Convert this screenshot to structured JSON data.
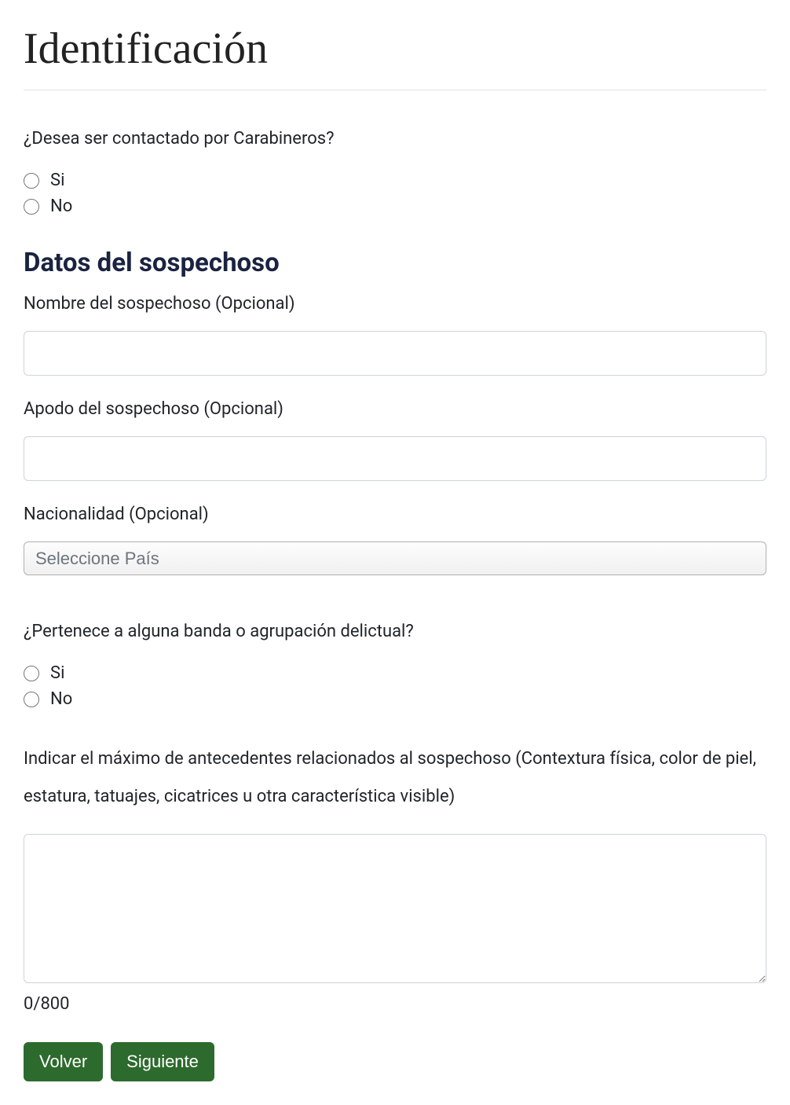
{
  "page": {
    "title": "Identificación"
  },
  "contact_question": {
    "label": "¿Desea ser contactado por Carabineros?",
    "options": {
      "yes": "Si",
      "no": "No"
    }
  },
  "suspect_section": {
    "heading": "Datos del sospechoso",
    "name": {
      "label": "Nombre del sospechoso (Opcional)",
      "value": ""
    },
    "nickname": {
      "label": "Apodo del sospechoso (Opcional)",
      "value": ""
    },
    "nationality": {
      "label": "Nacionalidad (Opcional)",
      "placeholder": "Seleccione País"
    },
    "gang_question": {
      "label": "¿Pertenece a alguna banda o agrupación delictual?",
      "options": {
        "yes": "Si",
        "no": "No"
      }
    },
    "details": {
      "label": "Indicar el máximo de antecedentes relacionados al sospechoso (Contextura física, color de piel, estatura, tatuajes, cicatrices u otra característica visible)",
      "value": "",
      "counter": "0/800"
    }
  },
  "buttons": {
    "back": "Volver",
    "next": "Siguiente"
  }
}
